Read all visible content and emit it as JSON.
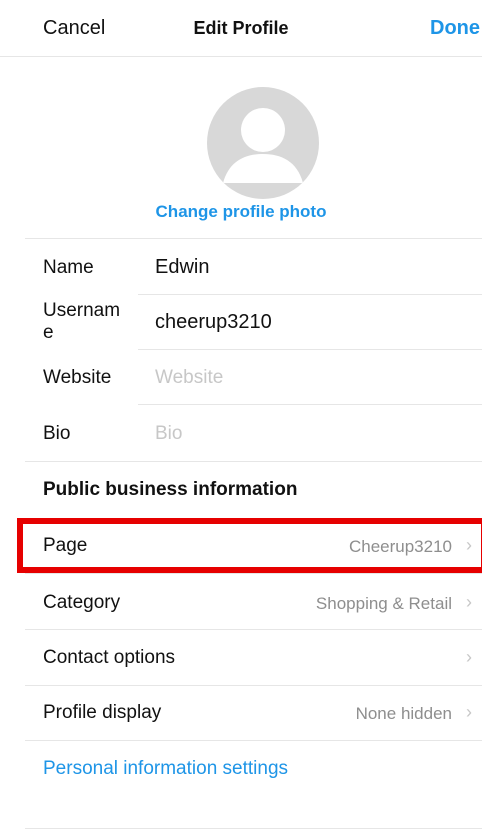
{
  "header": {
    "cancel_label": "Cancel",
    "title": "Edit Profile",
    "done_label": "Done"
  },
  "profile_photo": {
    "change_label": "Change profile photo"
  },
  "fields": [
    {
      "label": "Name",
      "value": "Edwin",
      "placeholder": ""
    },
    {
      "label": "Usernam e",
      "value": "cheerup3210",
      "placeholder": ""
    },
    {
      "label": "Website",
      "value": "",
      "placeholder": "Website"
    },
    {
      "label": "Bio",
      "value": "",
      "placeholder": "Bio"
    }
  ],
  "business": {
    "section_title": "Public business information",
    "rows": [
      {
        "label": "Page",
        "value": "Cheerup3210"
      },
      {
        "label": "Category",
        "value": "Shopping & Retail"
      },
      {
        "label": "Contact options",
        "value": ""
      },
      {
        "label": "Profile display",
        "value": "None hidden"
      }
    ]
  },
  "personal_settings_label": "Personal information settings",
  "colors": {
    "accent": "#1e95e7",
    "highlight": "#e60000"
  }
}
